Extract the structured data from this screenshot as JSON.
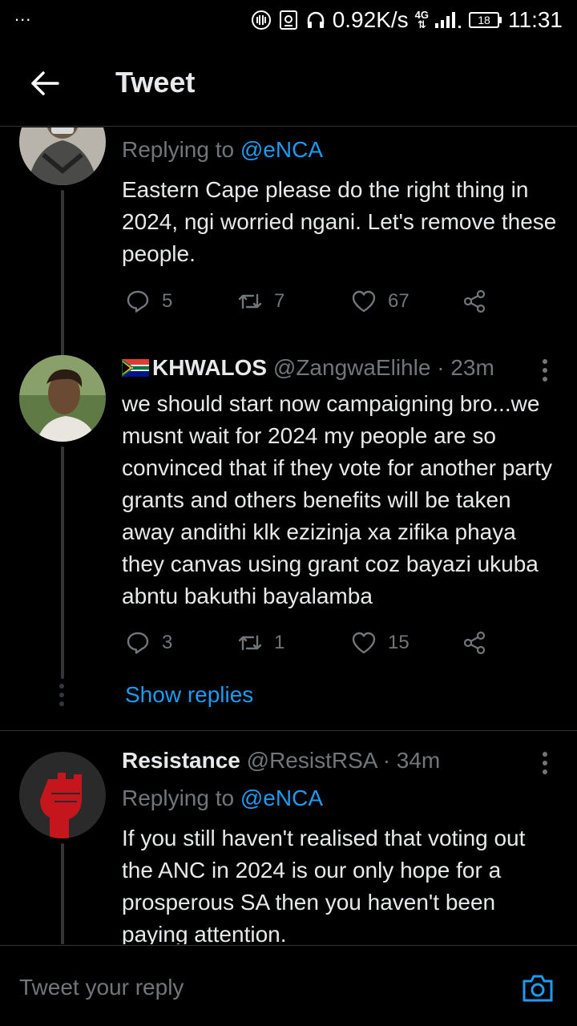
{
  "status_bar": {
    "dots": "...",
    "speed": "0.92K/s",
    "network": "4G",
    "battery": "18",
    "time": "11:31"
  },
  "header": {
    "title": "Tweet"
  },
  "tweets": [
    {
      "replying_label": "Replying to",
      "replying_to": "@eNCA",
      "text": "Eastern Cape please do the right thing in 2024, ngi worried ngani. Let's remove these people.",
      "replies": "5",
      "retweets": "7",
      "likes": "67"
    },
    {
      "name": "KHWALOS",
      "handle": "@ZangwaElihle",
      "time": "· 23m",
      "text": "we should start now campaigning bro...we musnt wait for 2024 my people are so convinced that if they vote for another party grants and others benefits will be taken away andithi klk ezizinja xa zifika phaya they canvas using grant coz bayazi ukuba abntu bakuthi bayalamba",
      "replies": "3",
      "retweets": "1",
      "likes": "15",
      "show_replies": "Show replies"
    },
    {
      "name": "Resistance",
      "handle": "@ResistRSA",
      "time": "· 34m",
      "replying_label": "Replying to",
      "replying_to": "@eNCA",
      "text": "If you still haven't realised that voting out the ANC in 2024 is our only hope for a prosperous SA then you haven't been paying attention."
    }
  ],
  "compose": {
    "placeholder": "Tweet your reply"
  },
  "colors": {
    "accent": "#1d9bf0",
    "muted": "#71767b",
    "background": "#000000"
  }
}
